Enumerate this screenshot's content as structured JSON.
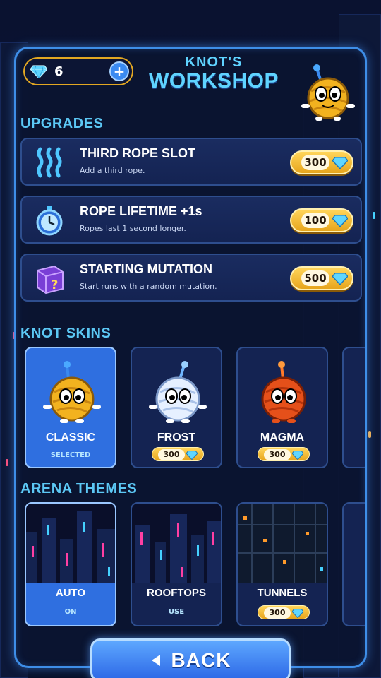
{
  "header": {
    "gem_count": "6",
    "plus_label": "+",
    "title_line1": "KNOT'S",
    "title_line2": "WORKSHOP"
  },
  "sections": {
    "upgrades": "UPGRADES",
    "skins": "KNOT SKINS",
    "themes": "ARENA THEMES"
  },
  "upgrades": [
    {
      "name": "THIRD ROPE SLOT",
      "desc": "Add a third rope.",
      "price": "300",
      "icon": "rope-icon"
    },
    {
      "name": "ROPE LIFETIME +1s",
      "desc": "Ropes last 1 second longer.",
      "price": "100",
      "icon": "stopwatch-icon"
    },
    {
      "name": "STARTING MUTATION",
      "desc": "Start runs with a random mutation.",
      "price": "500",
      "icon": "mystery-box-icon"
    }
  ],
  "skins": [
    {
      "name": "CLASSIC",
      "status": "SELECTED",
      "color": "#f2b21f"
    },
    {
      "name": "FROST",
      "price": "300",
      "color": "#e6f0ff"
    },
    {
      "name": "MAGMA",
      "price": "300",
      "color": "#e5501a"
    }
  ],
  "themes": [
    {
      "name": "AUTO",
      "status": "ON"
    },
    {
      "name": "ROOFTOPS",
      "status": "USE"
    },
    {
      "name": "TUNNELS",
      "price": "300"
    }
  ],
  "back_label": "BACK",
  "colors": {
    "accent": "#5fd3ff",
    "panel_border": "#3e8ee8",
    "gold": "#f2b21f",
    "selected": "#2f6fe0"
  }
}
